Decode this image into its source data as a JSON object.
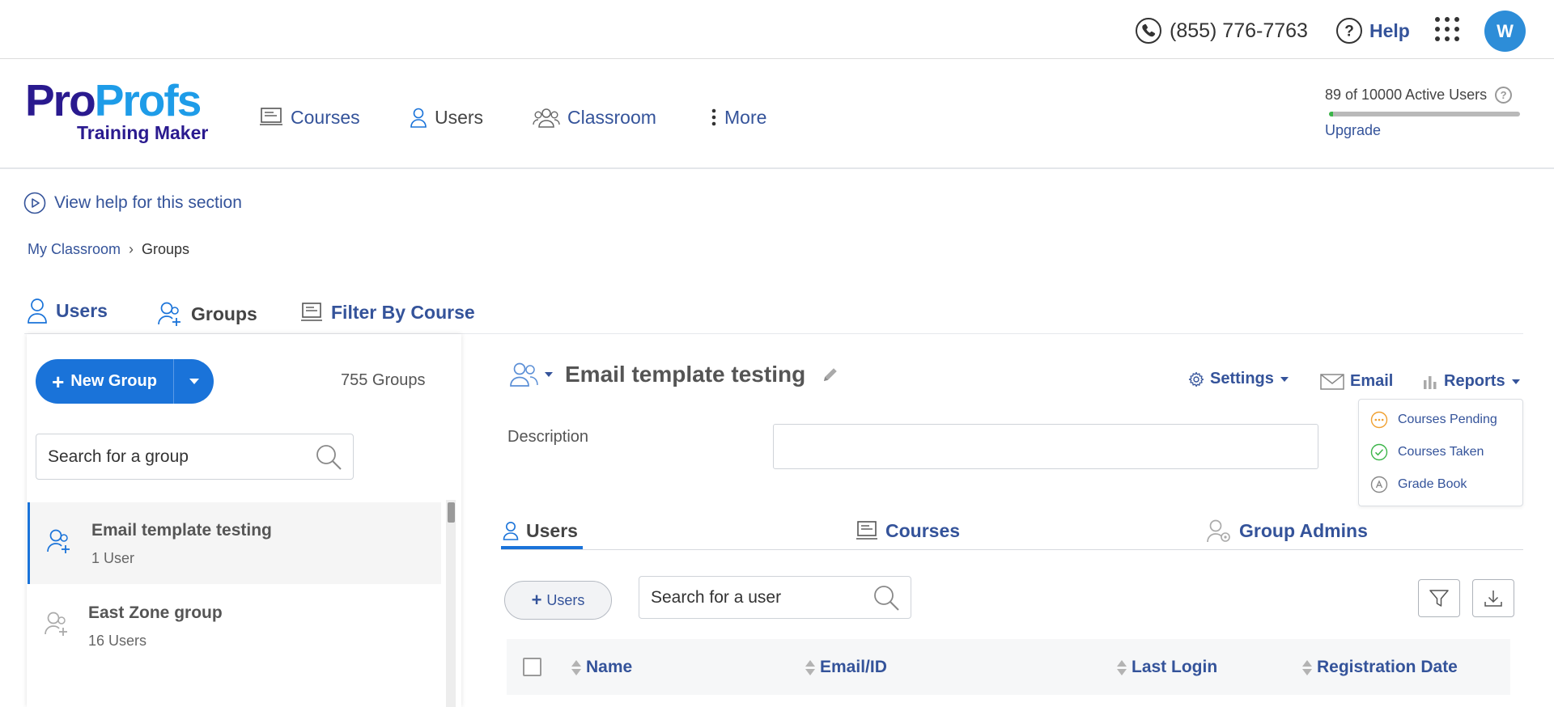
{
  "topbar": {
    "phone": "(855) 776-7763",
    "help_label": "Help",
    "avatar_initial": "W"
  },
  "brand": {
    "logo_part1": "Pro",
    "logo_part2": "Profs",
    "product": "Training Maker"
  },
  "nav": {
    "courses": "Courses",
    "users": "Users",
    "classroom": "Classroom",
    "more": "More"
  },
  "license": {
    "active_users_text": "89 of 10000 Active Users",
    "usage_fraction": 0.0089,
    "upgrade_label": "Upgrade"
  },
  "help_link": "View help for this section",
  "breadcrumb": {
    "parent": "My Classroom",
    "separator": "›",
    "current": "Groups"
  },
  "main_tabs": {
    "users": "Users",
    "groups": "Groups",
    "filter_by_course": "Filter By Course"
  },
  "left_panel": {
    "new_group_label": "New Group",
    "group_count": "755 Groups",
    "search_placeholder": "Search for a group",
    "groups": [
      {
        "name": "Email template testing",
        "count": "1 User",
        "selected": true
      },
      {
        "name": "East Zone group",
        "count": "16 Users",
        "selected": false
      }
    ]
  },
  "group_detail": {
    "title": "Email template testing",
    "settings_label": "Settings",
    "email_label": "Email",
    "reports_label": "Reports",
    "description_label": "Description",
    "description_value": "",
    "reports_menu": [
      "Courses Pending",
      "Courses Taken",
      "Grade Book"
    ],
    "sub_tabs": {
      "users": "Users",
      "courses": "Courses",
      "group_admins": "Group Admins"
    },
    "add_users_label": "Users",
    "user_search_placeholder": "Search for a user",
    "table_headers": {
      "name": "Name",
      "email": "Email/ID",
      "last_login": "Last Login",
      "registration_date": "Registration Date"
    }
  },
  "colors": {
    "primary_blue": "#1a73d9",
    "link_blue": "#34539a",
    "logo_navy": "#2a1a8f",
    "logo_cyan": "#1e9ce8",
    "avatar_blue": "#2d8dd8",
    "usage_green": "#3cb54a",
    "pending_orange": "#f0a030",
    "taken_green": "#3cb54a"
  },
  "icons": [
    "phone-icon",
    "help-icon",
    "apps-grid-icon",
    "courses-icon",
    "user-icon",
    "classroom-icon",
    "more-dots-icon",
    "play-circle-icon",
    "groups-icon",
    "search-icon",
    "edit-pencil-icon",
    "gear-icon",
    "mail-icon",
    "bar-chart-icon",
    "filter-icon",
    "download-icon"
  ]
}
